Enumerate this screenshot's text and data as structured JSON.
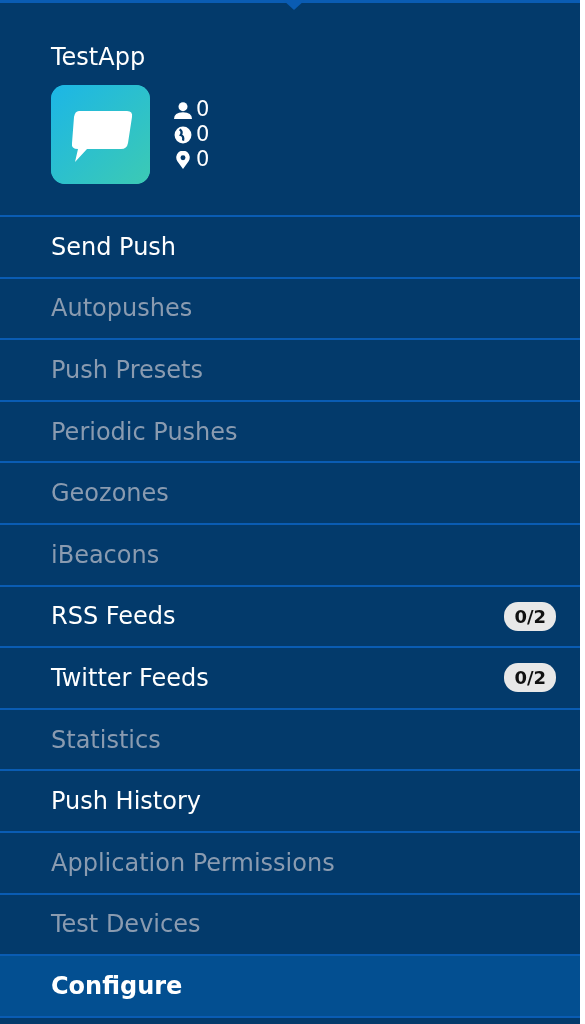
{
  "app": {
    "name": "TestApp",
    "stats": [
      {
        "kind": "users",
        "count": "0"
      },
      {
        "kind": "globe",
        "count": "0"
      },
      {
        "kind": "pin",
        "count": "0"
      }
    ]
  },
  "menu": [
    {
      "label": "Send Push",
      "disabled": false,
      "selected": false
    },
    {
      "label": "Autopushes",
      "disabled": true,
      "selected": false
    },
    {
      "label": "Push Presets",
      "disabled": true,
      "selected": false
    },
    {
      "label": "Periodic Pushes",
      "disabled": true,
      "selected": false
    },
    {
      "label": "Geozones",
      "disabled": true,
      "selected": false
    },
    {
      "label": "iBeacons",
      "disabled": true,
      "selected": false
    },
    {
      "label": "RSS Feeds",
      "disabled": false,
      "selected": false,
      "badge": "0/2"
    },
    {
      "label": "Twitter Feeds",
      "disabled": false,
      "selected": false,
      "badge": "0/2"
    },
    {
      "label": "Statistics",
      "disabled": true,
      "selected": false
    },
    {
      "label": "Push History",
      "disabled": false,
      "selected": false
    },
    {
      "label": "Application Permissions",
      "disabled": true,
      "selected": false
    },
    {
      "label": "Test Devices",
      "disabled": true,
      "selected": false
    },
    {
      "label": "Configure",
      "disabled": false,
      "selected": true
    }
  ]
}
